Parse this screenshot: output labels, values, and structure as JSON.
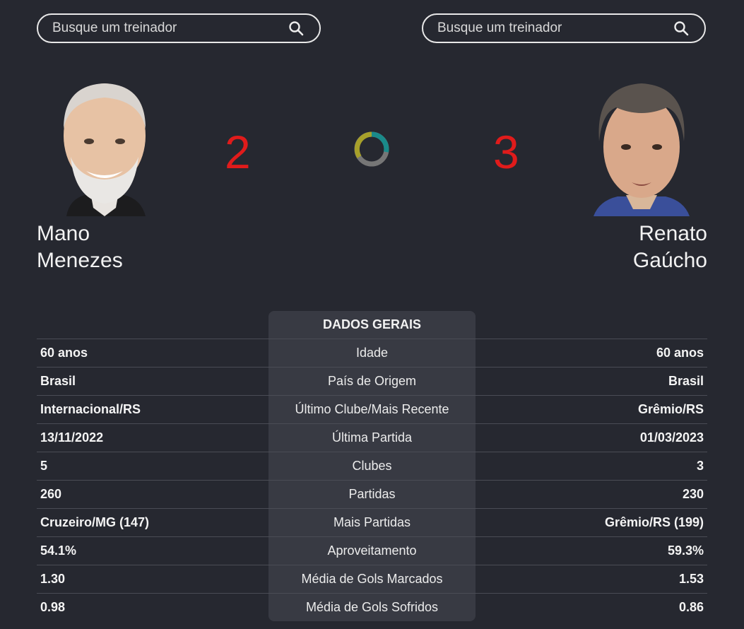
{
  "search": {
    "left_placeholder": "Busque um treinador",
    "right_placeholder": "Busque um treinador"
  },
  "coach_left": {
    "first_name": "Mano",
    "last_name": "Menezes",
    "score": "2"
  },
  "coach_right": {
    "first_name": "Renato",
    "last_name": "Gaúcho",
    "score": "3"
  },
  "spinner": {
    "colors": [
      "#1a8a8a",
      "#7a7a7a",
      "#a7a02a"
    ]
  },
  "stats": {
    "title": "DADOS GERAIS",
    "rows": [
      {
        "left": "60 anos",
        "label": "Idade",
        "right": "60 anos"
      },
      {
        "left": "Brasil",
        "label": "País de Origem",
        "right": "Brasil"
      },
      {
        "left": "Internacional/RS",
        "label": "Último Clube/Mais Recente",
        "right": "Grêmio/RS"
      },
      {
        "left": "13/11/2022",
        "label": "Última Partida",
        "right": "01/03/2023"
      },
      {
        "left": "5",
        "label": "Clubes",
        "right": "3"
      },
      {
        "left": "260",
        "label": "Partidas",
        "right": "230"
      },
      {
        "left": "Cruzeiro/MG (147)",
        "label": "Mais Partidas",
        "right": "Grêmio/RS (199)"
      },
      {
        "left": "54.1%",
        "label": "Aproveitamento",
        "right": "59.3%"
      },
      {
        "left": "1.30",
        "label": "Média de Gols Marcados",
        "right": "1.53"
      },
      {
        "left": "0.98",
        "label": "Média de Gols Sofridos",
        "right": "0.86"
      }
    ]
  }
}
